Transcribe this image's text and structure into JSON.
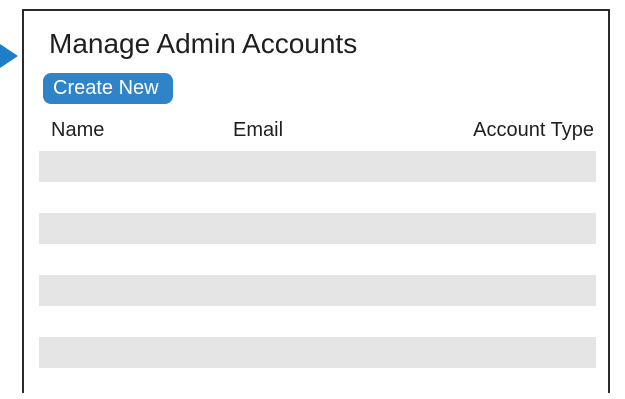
{
  "page": {
    "title": "Manage Admin Accounts"
  },
  "toolbar": {
    "create_label": "Create New"
  },
  "table": {
    "columns": [
      "Name",
      "Email",
      "Account Type"
    ],
    "row_count": 4
  },
  "colors": {
    "accent": "#2f84c9",
    "pointer": "#1f7ec8",
    "row_fill": "#e5e5e5",
    "border": "#2a2a2a"
  },
  "icons": {
    "pointer": "arrow-right-icon"
  }
}
